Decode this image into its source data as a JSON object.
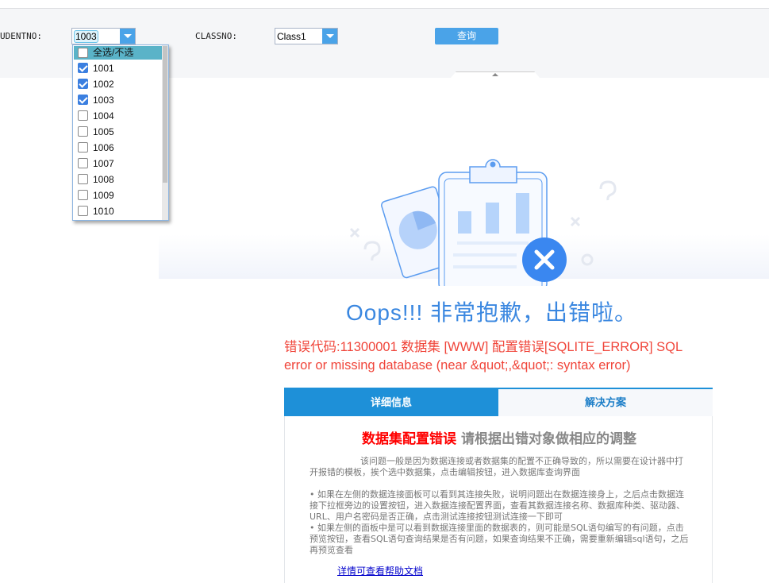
{
  "filter": {
    "studentno_label": "UDENTNO:",
    "studentno_value": "1003",
    "classno_label": "CLASSNO:",
    "classno_value": "Class1",
    "query_label": "查询"
  },
  "dropdown": {
    "select_all_label": "全选/不选",
    "options": [
      {
        "label": "1001",
        "checked": true
      },
      {
        "label": "1002",
        "checked": true
      },
      {
        "label": "1003",
        "checked": true
      },
      {
        "label": "1004",
        "checked": false
      },
      {
        "label": "1005",
        "checked": false
      },
      {
        "label": "1006",
        "checked": false
      },
      {
        "label": "1007",
        "checked": false
      },
      {
        "label": "1008",
        "checked": false
      },
      {
        "label": "1009",
        "checked": false
      },
      {
        "label": "1010",
        "checked": false
      }
    ]
  },
  "error": {
    "title": "Oops!!! 非常抱歉，出错啦。",
    "message": "错误代码:11300001 数据集 [WWW] 配置错误[SQLITE_ERROR] SQL error or missing database (near &quot;,&quot;: syntax error)"
  },
  "tabs": {
    "details": "详细信息",
    "solution": "解决方案"
  },
  "panel": {
    "title_red": "数据集配置错误",
    "title_gray": "请根据出错对象做相应的调整",
    "para1": "该问题一般是因为数据连接或者数据集的配置不正确导致的，所以需要在设计器中打开报错的模板，挨个选中数据集，点击编辑按钮，进入数据库查询界面",
    "bullet1": "•  如果在左侧的数据连接面板可以看到其连接失败，说明问题出在数据连接身上，之后点击数据连接下拉框旁边的设置按钮，进入数据连接配置界面，查看其数据连接名称、数据库种类、驱动器、URL、用户名密码是否正确，点击测试连接按钮测试连接一下即可",
    "bullet2": "•  如果左侧的面板中是可以看到数据连接里面的数据表的，则可能是SQL语句编写的有问题，点击预览按钮，查看SQL语句查询结果是否有问题，如果查询结果不正确，需要重新编辑sql语句，之后再预览查看",
    "help_link": "详情可查看帮助文档"
  }
}
